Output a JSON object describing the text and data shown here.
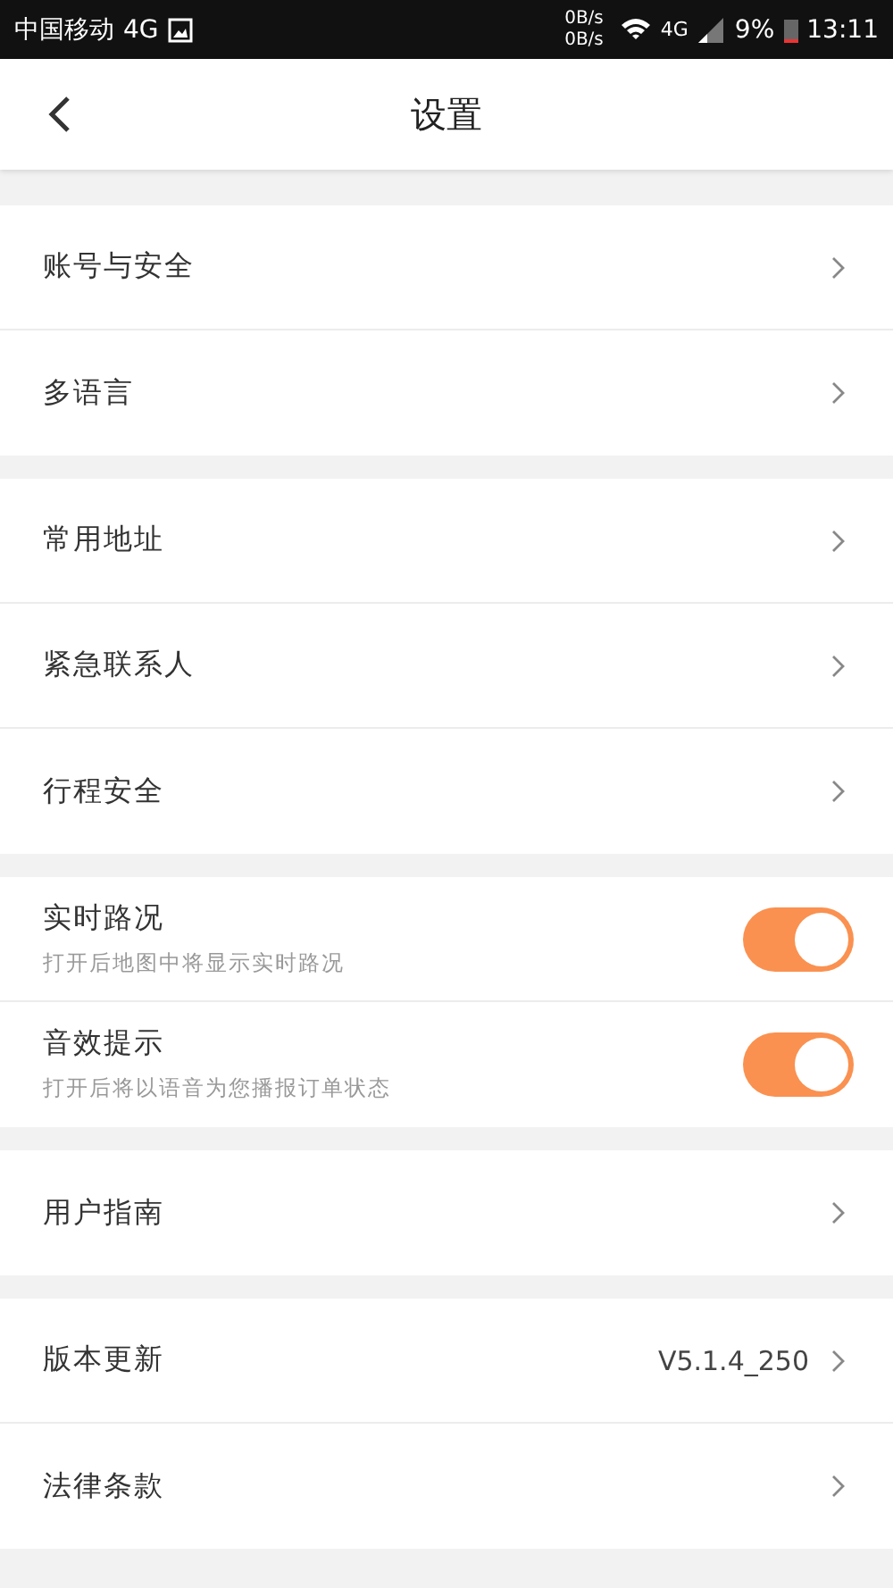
{
  "status_bar": {
    "carrier": "中国移动",
    "network": "4G",
    "speed_up": "0B/s",
    "speed_down": "0B/s",
    "signal_type": "4G",
    "battery": "9%",
    "time": "13:11"
  },
  "header": {
    "title": "设置"
  },
  "sections": [
    {
      "items": [
        {
          "kind": "link",
          "label": "账号与安全"
        },
        {
          "kind": "link",
          "label": "多语言"
        }
      ]
    },
    {
      "items": [
        {
          "kind": "link",
          "label": "常用地址"
        },
        {
          "kind": "link",
          "label": "紧急联系人"
        },
        {
          "kind": "link",
          "label": "行程安全"
        }
      ]
    },
    {
      "items": [
        {
          "kind": "toggle",
          "label": "实时路况",
          "description": "打开后地图中将显示实时路况",
          "on": true
        },
        {
          "kind": "toggle",
          "label": "音效提示",
          "description": "打开后将以语音为您播报订单状态",
          "on": true
        }
      ]
    },
    {
      "items": [
        {
          "kind": "link",
          "label": "用户指南"
        }
      ]
    },
    {
      "items": [
        {
          "kind": "link",
          "label": "版本更新",
          "value": "V5.1.4_250"
        },
        {
          "kind": "link",
          "label": "法律条款"
        }
      ]
    }
  ]
}
